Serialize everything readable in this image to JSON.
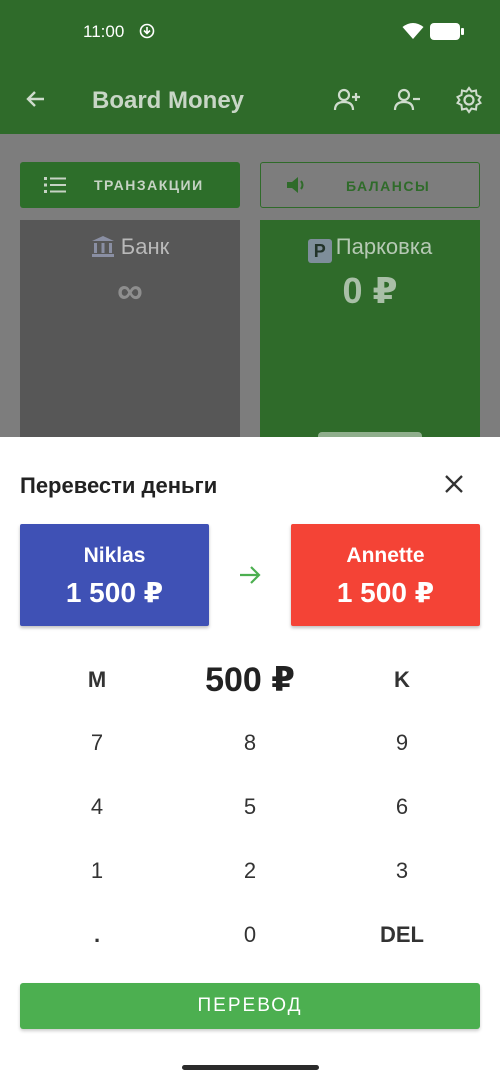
{
  "status": {
    "time": "11:00"
  },
  "appbar": {
    "title": "Board Money"
  },
  "tabs": {
    "transactions": "ТРАНЗАКЦИИ",
    "balances": "БАЛАНСЫ"
  },
  "cards": {
    "bank": {
      "name": "Банк",
      "value": "∞"
    },
    "parking": {
      "icon_letter": "P",
      "name": "Парковка",
      "value": "0 ₽"
    }
  },
  "sheet": {
    "title": "Перевести деньги",
    "from": {
      "name": "Niklas",
      "balance": "1 500 ₽"
    },
    "to": {
      "name": "Annette",
      "balance": "1 500 ₽"
    },
    "amount": "500 ₽",
    "keys": {
      "m": "M",
      "k": "K",
      "k7": "7",
      "k8": "8",
      "k9": "9",
      "k4": "4",
      "k5": "5",
      "k6": "6",
      "k1": "1",
      "k2": "2",
      "k3": "3",
      "dot": ".",
      "k0": "0",
      "del": "DEL"
    },
    "transfer_label": "ПЕРЕВОД"
  },
  "colors": {
    "primary": "#2f6b2a",
    "from_card": "#3f51b5",
    "to_card": "#f44336",
    "action": "#4caf50"
  }
}
